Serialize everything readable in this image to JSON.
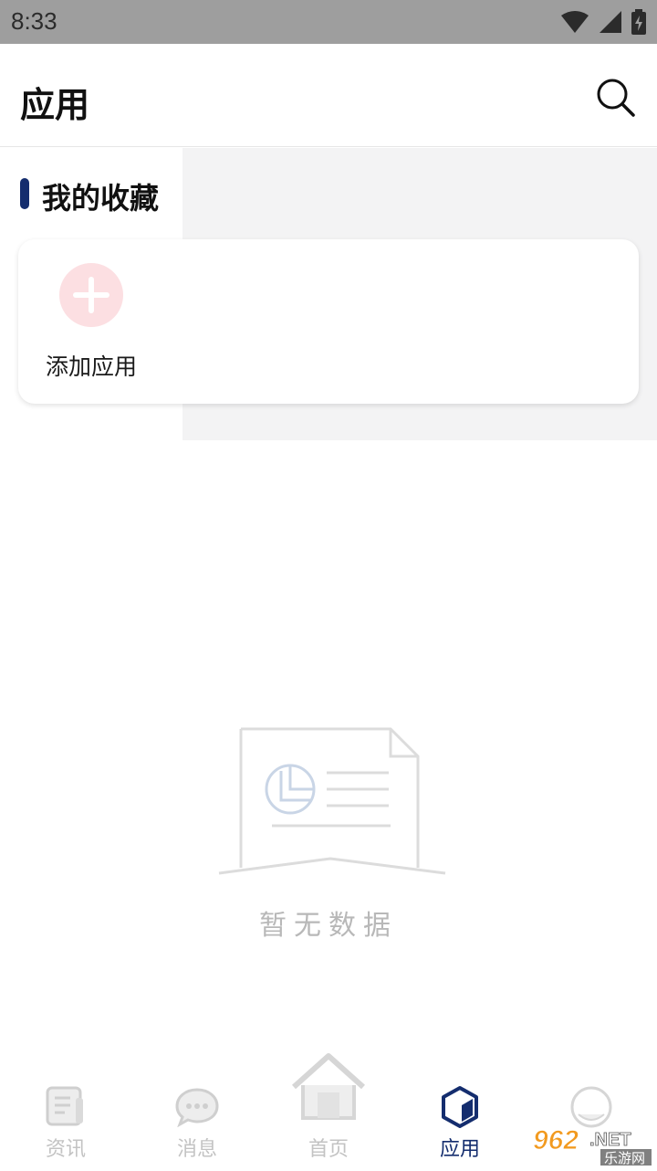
{
  "status_bar": {
    "time": "8:33"
  },
  "header": {
    "title": "应用",
    "search_icon": "search-icon"
  },
  "favorites": {
    "section_title": "我的收藏",
    "add_label": "添加应用",
    "accent_color": "#142d6e",
    "add_circle_color": "#fcdfe2"
  },
  "empty_state": {
    "text": "暂无数据",
    "icon": "empty-document-icon"
  },
  "tabbar": {
    "tabs": [
      {
        "label": "资讯",
        "icon": "news-icon",
        "active": false
      },
      {
        "label": "消息",
        "icon": "chat-bubble-icon",
        "active": false
      },
      {
        "label": "首页",
        "icon": "home-icon",
        "active": false
      },
      {
        "label": "应用",
        "icon": "cube-icon",
        "active": true
      },
      {
        "label": "",
        "icon": "profile-icon",
        "active": false
      }
    ]
  },
  "watermark": {
    "number": "962",
    "suffix": ".NET",
    "tagline": "乐游网"
  }
}
